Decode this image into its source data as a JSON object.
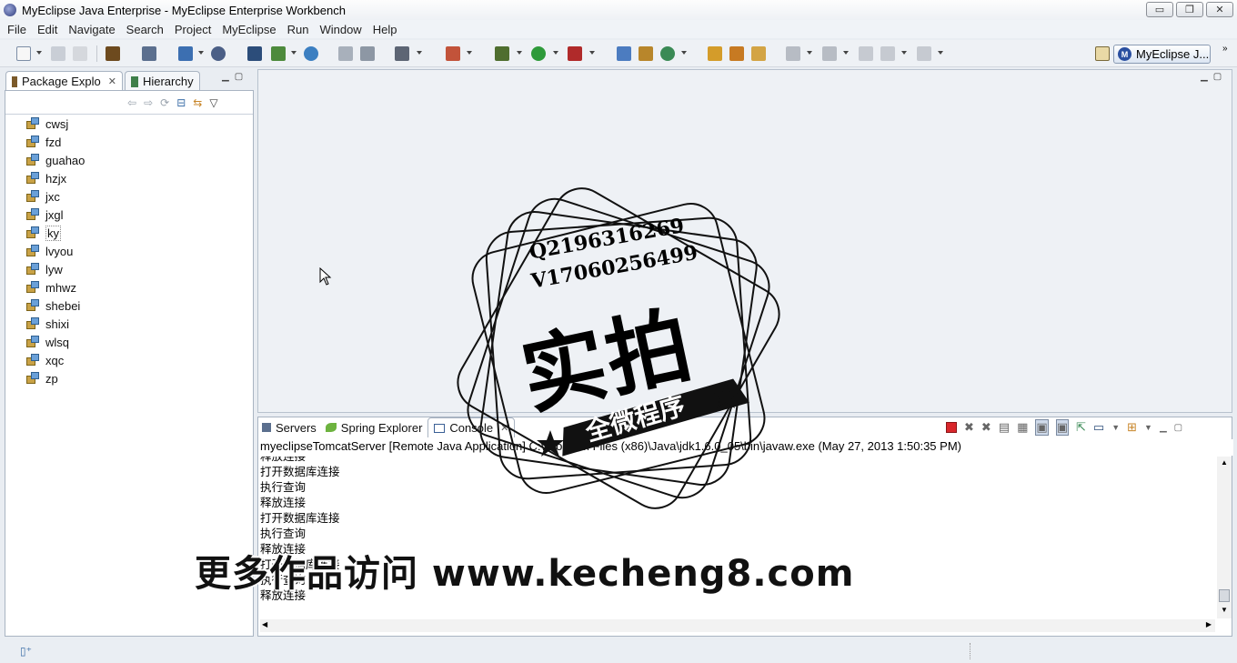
{
  "window": {
    "title": "MyEclipse Java Enterprise - MyEclipse Enterprise Workbench",
    "minimize_glyph": "▭",
    "restore_glyph": "❐",
    "close_glyph": "✕"
  },
  "menu": [
    "File",
    "Edit",
    "Navigate",
    "Search",
    "Project",
    "MyEclipse",
    "Run",
    "Window",
    "Help"
  ],
  "perspective": {
    "label": "MyEclipse J...",
    "logo_letter": "M"
  },
  "package_explorer": {
    "tab_label": "Package Explo",
    "hierarchy_label": "Hierarchy",
    "projects": [
      "cwsj",
      "fzd",
      "guahao",
      "hzjx",
      "jxc",
      "jxgl",
      "ky",
      "lvyou",
      "lyw",
      "mhwz",
      "shebei",
      "shixi",
      "wlsq",
      "xqc",
      "zp"
    ],
    "selected": "ky"
  },
  "bottom_tabs": {
    "servers": "Servers",
    "spring": "Spring Explorer",
    "console": "Console"
  },
  "console": {
    "header": "myeclipseTomcatServer [Remote Java Application] C:\\Program Files (x86)\\Java\\jdk1.6.0_05\\bin\\javaw.exe (May 27, 2013 1:50:35 PM)",
    "lines": [
      "释放连接",
      "打开数据库连接",
      "执行查询",
      "释放连接",
      "打开数据库连接",
      "执行查询",
      "释放连接",
      "打开数据库连接",
      "执行查询",
      "释放连接"
    ]
  },
  "watermark": {
    "qq": "Q2196316269",
    "wechat": "V17060256499",
    "big": "实拍",
    "ribbon": "全微程序",
    "banner": "更多作品访问 www.kecheng8.com"
  },
  "colors": {
    "panel_border": "#a9b4c2",
    "stop_red": "#d9262b"
  }
}
